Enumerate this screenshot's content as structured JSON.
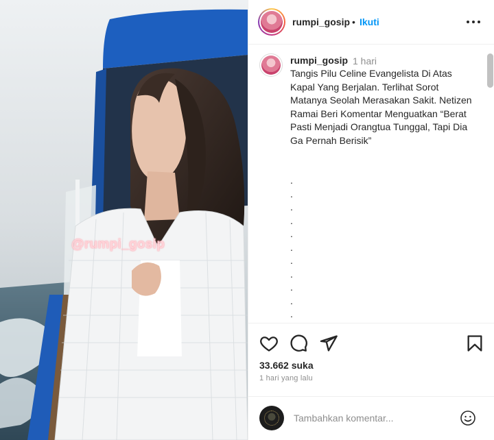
{
  "post": {
    "watermark": "@rumpi_gosip"
  },
  "header": {
    "username": "rumpi_gosip",
    "separator": "•",
    "follow_label": "Ikuti"
  },
  "caption": {
    "username": "rumpi_gosip",
    "time": "1 hari",
    "text": "Tangis Pilu Celine Evangelista Di Atas Kapal Yang Berjalan. Terlihat Sorot Matanya Seolah Merasakan Sakit. Netizen Ramai Beri Komentar Menguatkan “Berat Pasti Menjadi Orangtua Tunggal, Tapi Dia Ga Pernah Berisik”",
    "dots": [
      ".",
      ".",
      ".",
      ".",
      ".",
      ".",
      ".",
      ".",
      ".",
      ".",
      "."
    ]
  },
  "stats": {
    "likes": "33.662 suka",
    "time_ago": "1 hari yang lalu"
  },
  "comment": {
    "placeholder": "Tambahkan komentar..."
  },
  "icons": {
    "like": "heart-icon",
    "comment": "comment-icon",
    "share": "share-icon",
    "save": "bookmark-icon",
    "more": "more-icon",
    "emoji": "emoji-icon"
  },
  "colors": {
    "accent": "#0095f6",
    "text": "#262626",
    "muted": "#8e8e8e",
    "border": "#efefef"
  }
}
